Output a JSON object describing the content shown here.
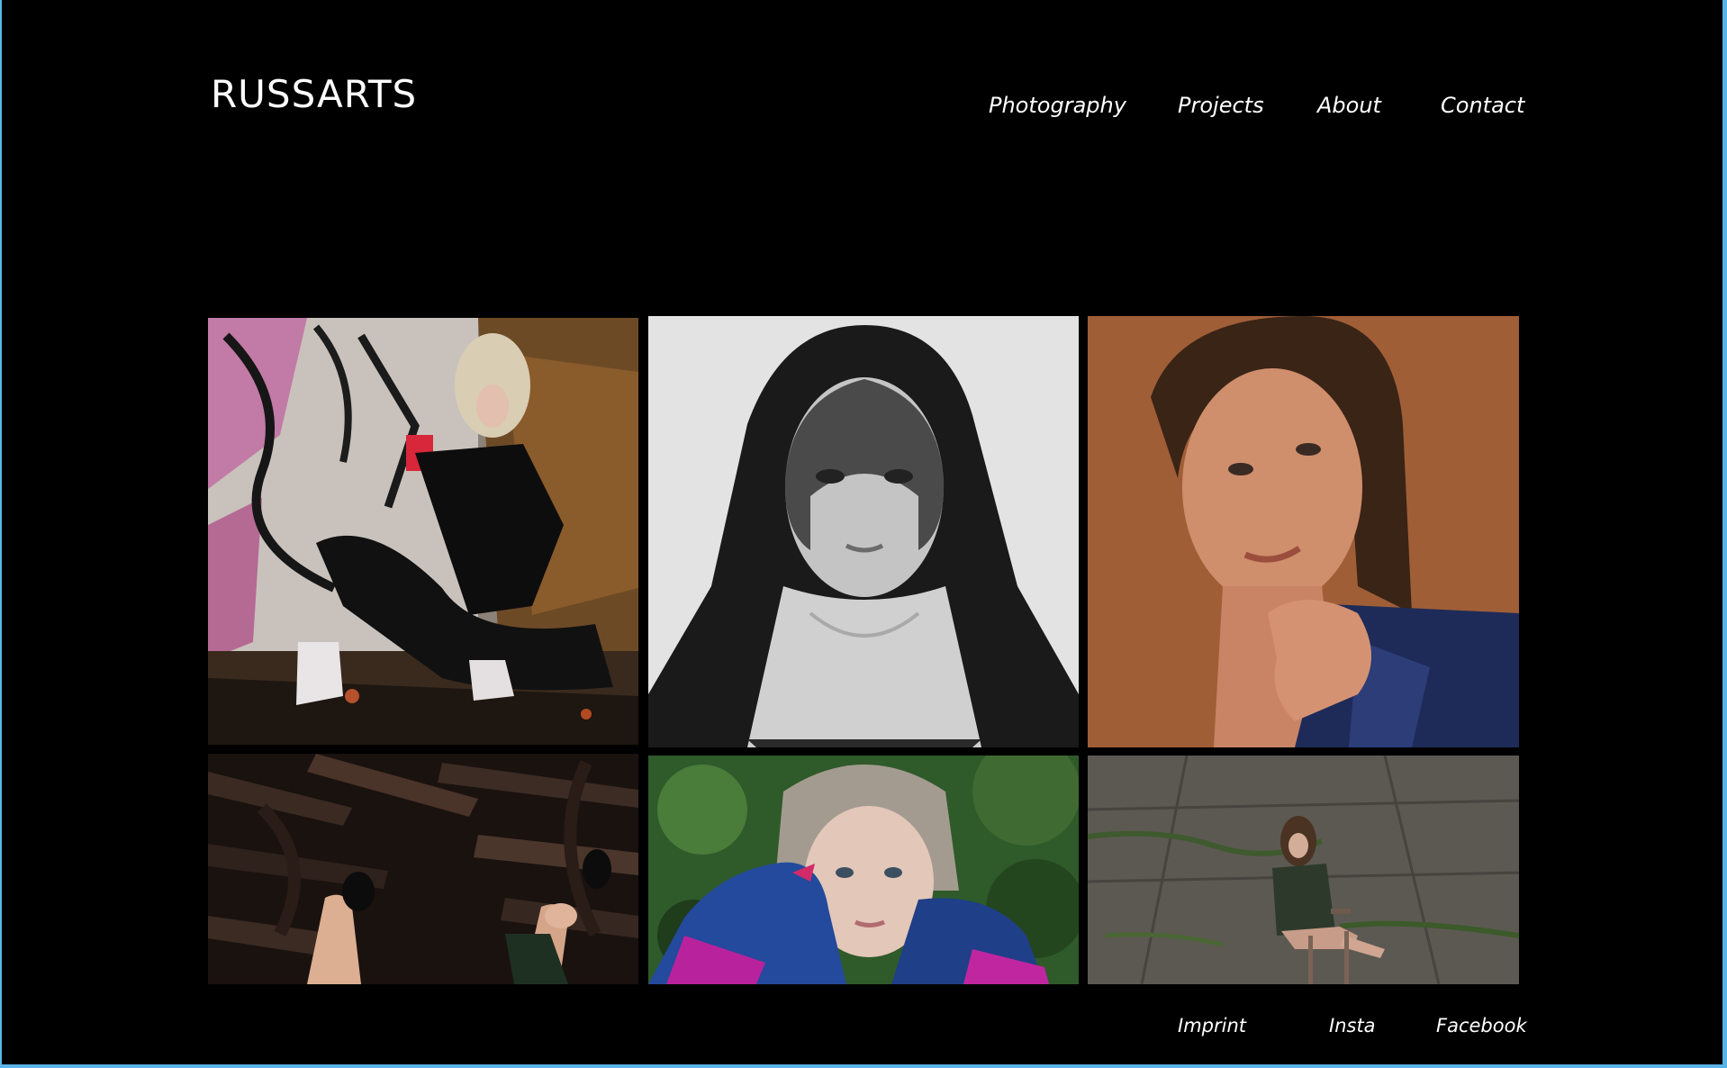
{
  "header": {
    "logo": "RUSSARTS"
  },
  "nav": {
    "items": [
      {
        "label": "Photography"
      },
      {
        "label": "Projects"
      },
      {
        "label": "About"
      },
      {
        "label": "Contact"
      }
    ]
  },
  "gallery": {
    "tiles": [
      {
        "kind": "color photo",
        "colors": [
          "#b8709a",
          "#7a5a2e",
          "#0e0c0d"
        ]
      },
      {
        "kind": "black and white photo",
        "colors": [
          "#e6e6e6",
          "#171717",
          "#a9a9a9"
        ]
      },
      {
        "kind": "color photo",
        "colors": [
          "#9a5a33",
          "#c98564",
          "#1d2a55"
        ]
      },
      {
        "kind": "color photo",
        "colors": [
          "#2a1d18",
          "#120c0a",
          "#d9a68a"
        ]
      },
      {
        "kind": "color photo",
        "colors": [
          "#3d6a32",
          "#264a9a",
          "#b5219a"
        ]
      },
      {
        "kind": "color photo",
        "colors": [
          "#5a5751",
          "#2f3a2b",
          "#c0a090"
        ]
      }
    ]
  },
  "footer": {
    "links": [
      {
        "label": "Imprint"
      },
      {
        "label": "Insta"
      },
      {
        "label": "Facebook"
      }
    ]
  }
}
